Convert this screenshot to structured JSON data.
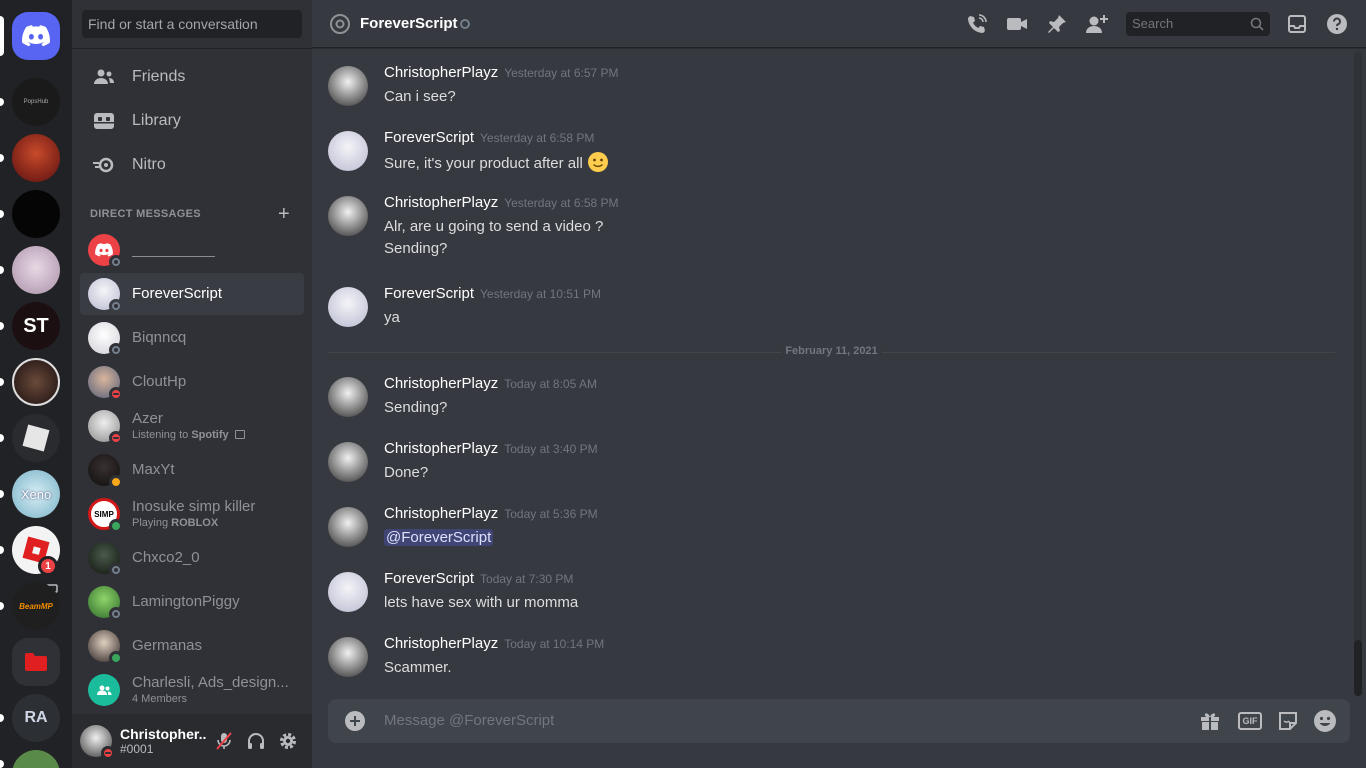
{
  "guilds": [
    {
      "name": "home",
      "color": "#5865f2"
    },
    {
      "name": "PopsHub",
      "color": "#1a1a1a"
    },
    {
      "name": "anime-server",
      "color": "#8b1e1e"
    },
    {
      "name": "dark-server",
      "color": "#050505"
    },
    {
      "name": "anime-girl-server",
      "color": "#cbb6c8"
    },
    {
      "name": "ST",
      "color": "#1c0f12"
    },
    {
      "name": "ghoul-server",
      "color": "#3a2a22"
    },
    {
      "name": "roblox-studio",
      "color": "#2a2b2e"
    },
    {
      "name": "Xeno",
      "color": "#9fc9d8"
    },
    {
      "name": "roblox",
      "color": "#f3f3f3"
    },
    {
      "name": "BeamMP",
      "color": "#1f1f1f"
    },
    {
      "name": "folder",
      "color": "#e02020"
    },
    {
      "name": "RA",
      "color": "#2c2f33"
    },
    {
      "name": "green-server",
      "color": "#5a8a4a"
    }
  ],
  "guild_badge": "1",
  "sidebar": {
    "search_placeholder": "Find or start a conversation",
    "nav": [
      {
        "label": "Friends",
        "icon": "friends-icon"
      },
      {
        "label": "Library",
        "icon": "library-icon"
      },
      {
        "label": "Nitro",
        "icon": "nitro-icon"
      }
    ],
    "dm_header": "DIRECT MESSAGES",
    "dms": [
      {
        "name": "__________",
        "sub": "",
        "status": "offline"
      },
      {
        "name": "ForeverScript",
        "sub": "",
        "status": "offline",
        "active": true
      },
      {
        "name": "Biqnncq",
        "sub": "",
        "status": "offline"
      },
      {
        "name": "CloutHp",
        "sub": "",
        "status": "dnd"
      },
      {
        "name": "Azer",
        "sub_prefix": "Listening to ",
        "sub_bold": "Spotify",
        "status": "dnd"
      },
      {
        "name": "MaxYt",
        "sub": "",
        "status": "idle"
      },
      {
        "name": "Inosuke simp killer",
        "sub_prefix": "Playing ",
        "sub_bold": "ROBLOX",
        "status": "online"
      },
      {
        "name": "Chxco2_0",
        "sub": "",
        "status": "offline"
      },
      {
        "name": "LamingtonPiggy",
        "sub": "",
        "status": "offline"
      },
      {
        "name": "Germanas",
        "sub": "",
        "status": "online"
      },
      {
        "name": "Charlesli, Ads_design...",
        "sub": "4 Members",
        "status": "none"
      }
    ]
  },
  "user": {
    "name": "Christopher...",
    "tag": "#0001"
  },
  "channel": {
    "name": "ForeverScript",
    "search_placeholder": "Search",
    "composer_placeholder": "Message @ForeverScript",
    "date_divider": "February 11, 2021"
  },
  "messages": [
    {
      "author": "ChristopherPlayz",
      "time": "Yesterday at 6:57 PM",
      "text": "Can i see?"
    },
    {
      "author": "ForeverScript",
      "time": "Yesterday at 6:58 PM",
      "text": "Sure, it's your product after all"
    },
    {
      "author": "ChristopherPlayz",
      "time": "Yesterday at 6:58 PM",
      "text": "Alr, are u going to send a video ?",
      "cont": "Sending?"
    },
    {
      "author": "ForeverScript",
      "time": "Yesterday at 10:51 PM",
      "text": "ya"
    },
    {
      "author": "ChristopherPlayz",
      "time": "Today at 8:05 AM",
      "text": "Sending?"
    },
    {
      "author": "ChristopherPlayz",
      "time": "Today at 3:40 PM",
      "text": "Done?"
    },
    {
      "author": "ChristopherPlayz",
      "time": "Today at 5:36 PM",
      "mention": "@ForeverScript"
    },
    {
      "author": "ForeverScript",
      "time": "Today at 7:30 PM",
      "text": "lets have sex with ur momma"
    },
    {
      "author": "ChristopherPlayz",
      "time": "Today at 10:14 PM",
      "text": "Scammer."
    }
  ],
  "composer": {
    "gif_label": "GIF"
  }
}
